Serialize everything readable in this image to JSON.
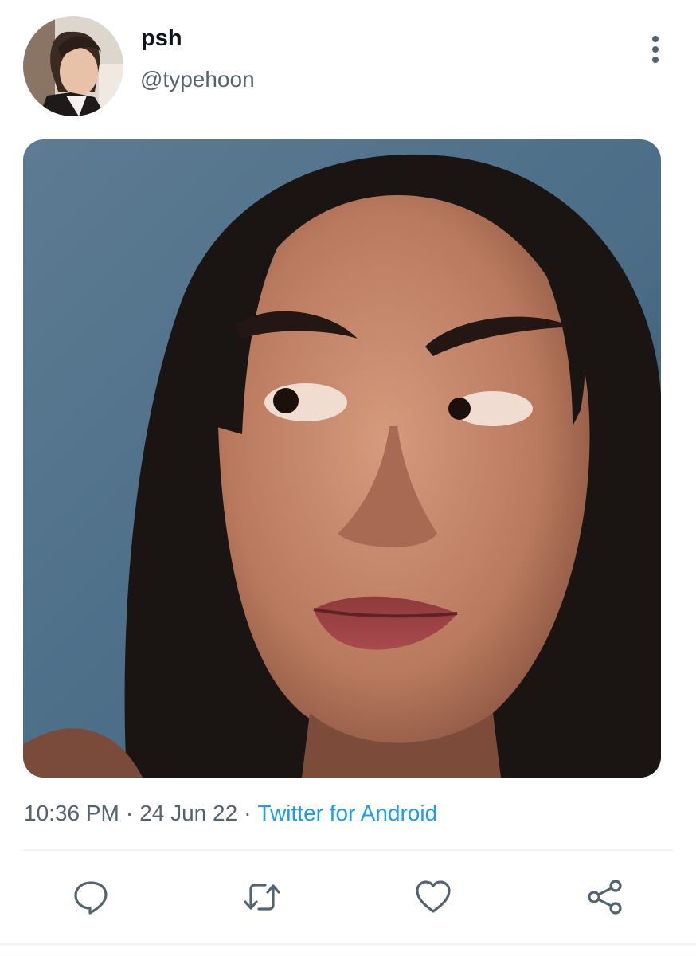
{
  "tweet": {
    "display_name": "psh",
    "handle": "@typehoon",
    "time": "10:36 PM",
    "date": "24 Jun 22",
    "separator": "·",
    "source": "Twitter for Android"
  },
  "icons": {
    "more": "more-vertical-icon",
    "reply": "reply-icon",
    "retweet": "retweet-icon",
    "like": "heart-icon",
    "share": "share-icon"
  },
  "colors": {
    "text_primary": "#0f1419",
    "text_secondary": "#536471",
    "link": "#1d9bf0",
    "divider": "#eff3f4"
  }
}
